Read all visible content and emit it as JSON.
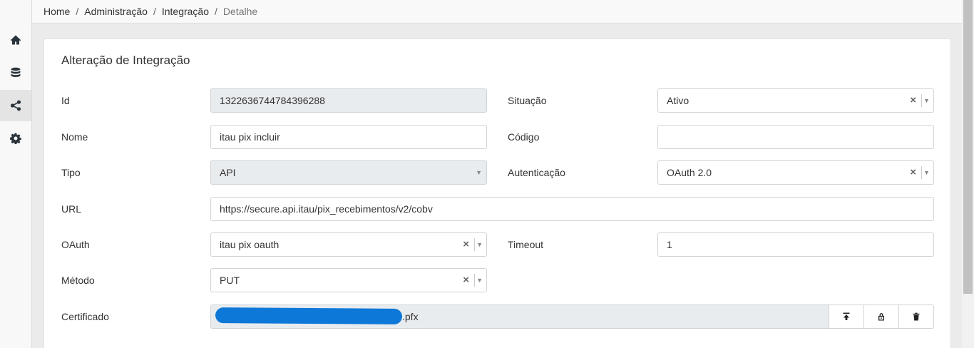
{
  "breadcrumb": {
    "items": [
      "Home",
      "Administração",
      "Integração"
    ],
    "current": "Detalhe",
    "separator": "/"
  },
  "sidebar": {
    "items": [
      {
        "icon": "home-icon"
      },
      {
        "icon": "database-icon"
      },
      {
        "icon": "share-icon",
        "active": true
      },
      {
        "icon": "gear-icon"
      }
    ]
  },
  "form": {
    "title": "Alteração de Integração",
    "id": {
      "label": "Id",
      "value": "1322636744784396288"
    },
    "situacao": {
      "label": "Situação",
      "value": "Ativo"
    },
    "nome": {
      "label": "Nome",
      "value": "itau pix incluir"
    },
    "codigo": {
      "label": "Código",
      "value": ""
    },
    "tipo": {
      "label": "Tipo",
      "value": "API"
    },
    "autenticacao": {
      "label": "Autenticação",
      "value": "OAuth 2.0"
    },
    "url": {
      "label": "URL",
      "value": "https://secure.api.itau/pix_recebimentos/v2/cobv"
    },
    "oauth": {
      "label": "OAuth",
      "value": "itau pix oauth"
    },
    "timeout": {
      "label": "Timeout",
      "value": "1"
    },
    "metodo": {
      "label": "Método",
      "value": "PUT"
    },
    "certificado": {
      "label": "Certificado",
      "value_suffix": ".pfx"
    }
  },
  "glyphs": {
    "clear": "×",
    "caret": "▼"
  },
  "colors": {
    "redaction": "#0e78d8"
  }
}
